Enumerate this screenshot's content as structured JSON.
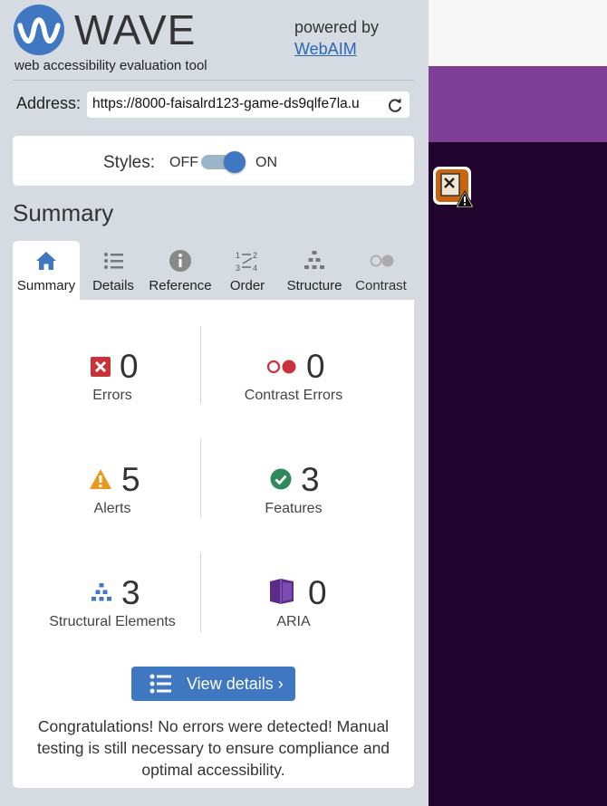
{
  "header": {
    "logo_text": "WAVE",
    "subtitle": "web accessibility evaluation tool",
    "powered_by": "powered by",
    "webaim_link": "WebAIM"
  },
  "address": {
    "label": "Address:",
    "value": "https://8000-faisalrd123-game-ds9qlfe7la.u"
  },
  "styles": {
    "label": "Styles:",
    "off": "OFF",
    "on": "ON",
    "state": "ON"
  },
  "summary_heading": "Summary",
  "tabs": [
    {
      "label": "Summary",
      "icon": "home-icon",
      "active": true
    },
    {
      "label": "Details",
      "icon": "list-icon"
    },
    {
      "label": "Reference",
      "icon": "info-icon"
    },
    {
      "label": "Order",
      "icon": "order-icon"
    },
    {
      "label": "Structure",
      "icon": "structure-icon"
    },
    {
      "label": "Contrast",
      "icon": "contrast-icon",
      "disabled": true
    }
  ],
  "stats": {
    "errors": {
      "count": "0",
      "label": "Errors",
      "icon": "error-icon",
      "color": "#c8323a"
    },
    "contrast_errors": {
      "count": "0",
      "label": "Contrast Errors",
      "icon": "contrast-error-icon",
      "color": "#c8323a"
    },
    "alerts": {
      "count": "5",
      "label": "Alerts",
      "icon": "alert-icon",
      "color": "#e79a1d"
    },
    "features": {
      "count": "3",
      "label": "Features",
      "icon": "feature-icon",
      "color": "#2f8a5b"
    },
    "structural": {
      "count": "3",
      "label": "Structural Elements",
      "icon": "structure-icon",
      "color": "#3f78c1"
    },
    "aria": {
      "count": "0",
      "label": "ARIA",
      "icon": "aria-icon",
      "color": "#5b2c86"
    }
  },
  "view_details": "View details ›",
  "congrats": "Congratulations! No errors were detected! Manual testing is still necessary to ensure compliance and optimal accessibility.",
  "colors": {
    "sidebar_bg": "#d5dbe1",
    "accent_blue": "#3f78c1",
    "page_dark": "#21052f",
    "page_purple": "#7f3f97"
  }
}
